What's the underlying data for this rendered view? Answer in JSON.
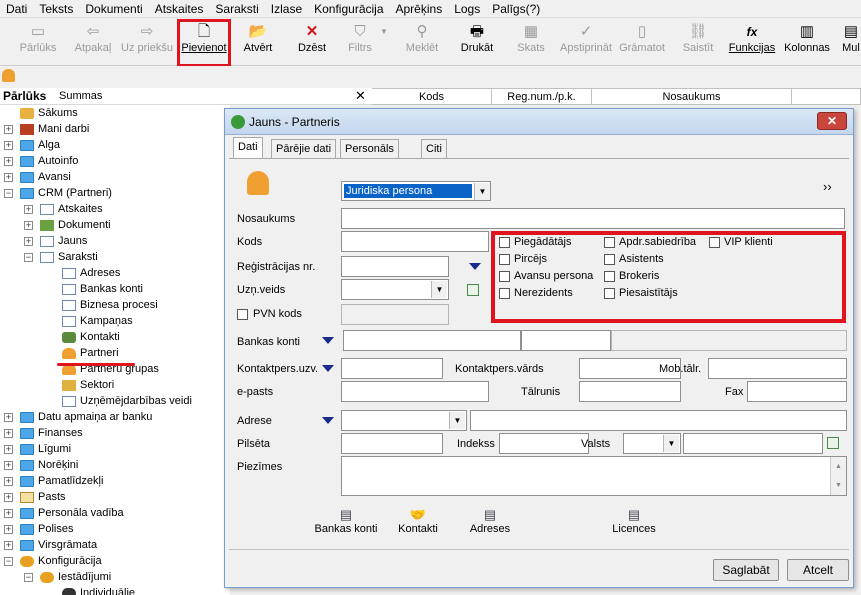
{
  "menubar": [
    "Dati",
    "Teksts",
    "Dokumenti",
    "Atskaites",
    "Saraksti",
    "Izlase",
    "Konfigurācija",
    "Aprēķins",
    "Logs",
    "Palīgs(?)"
  ],
  "toolbar": {
    "parluks": "Pārlūks",
    "atpakal": "Atpakaļ",
    "uzpriekšu": "Uz priekšu",
    "pievienot": "Pievienot",
    "atvert": "Atvērt",
    "dzest": "Dzēst",
    "filtrs": "Filtrs",
    "meklet": "Meklēt",
    "drukat": "Drukāt",
    "skats": "Skats",
    "apstiprinat": "Apstiprināt",
    "gramatot": "Grāmatot",
    "saistit": "Saistīt",
    "funkcijas": "Funkcijas",
    "kolonnas": "Kolonnas",
    "mul": "Mul"
  },
  "tree_header": {
    "title": "Pārlūks",
    "summas": "Summas",
    "close": "✕"
  },
  "grid_header": {
    "kods": "Kods",
    "regnum": "Reg.num./p.k.",
    "nosaukums": "Nosaukums"
  },
  "tree": {
    "sakums": "Sākums",
    "mani_darbi": "Mani darbi",
    "alga": "Alga",
    "autoinfo": "Autoinfo",
    "avansi": "Avansi",
    "crm": "CRM (Partneri)",
    "atskaites": "Atskaites",
    "dokumenti": "Dokumenti",
    "jauns": "Jauns",
    "saraksti": "Saraksti",
    "adreses": "Adreses",
    "bankas_konti": "Bankas konti",
    "biznesa_procesi": "Biznesa procesi",
    "kampanas": "Kampaņas",
    "kontakti": "Kontakti",
    "partneri": "Partneri",
    "partneru_grupas": "Partneru grupas",
    "sektori": "Sektori",
    "uznemdarbibas_veidi": "Uzņēmējdarbības veidi",
    "datu_apmaina": "Datu apmaiņa ar banku",
    "finanses": "Finanses",
    "ligumi": "Līgumi",
    "norekini": "Norēķini",
    "pamatlidzekli": "Pamatlīdzekļi",
    "pasts": "Pasts",
    "personala_vadiba": "Personāla vadība",
    "polises": "Polises",
    "virsgramata": "Virsgrāmata",
    "konfiguracija": "Konfigurācija",
    "iestadijumi": "Iestādījumi",
    "individualie": "Individuālie"
  },
  "dialog": {
    "title": "Jauns - Partneris",
    "close": "✕",
    "tabs": {
      "dati": "Dati",
      "parejie": "Pārējie dati",
      "personals": "Personāls",
      "citi": "Citi"
    },
    "type_value": "Juridiska persona",
    "more": "››",
    "labels": {
      "nosaukums": "Nosaukums",
      "kods": "Kods",
      "reg": "Reģistrācijas nr.",
      "uzn": "Uzņ.veids",
      "pvn": "PVN kods",
      "bankas": "Bankas konti",
      "kontuzv": "Kontaktpers.uzv.",
      "kontvards": "Kontaktpers.vārds",
      "mob": "Mob.tālr.",
      "epasts": "e-pasts",
      "talrunis": "Tālrunis",
      "fax": "Fax",
      "adrese": "Adrese",
      "pilseta": "Pilsēta",
      "indekss": "Indekss",
      "valsts": "Valsts",
      "piezimes": "Piezīmes"
    },
    "checks": {
      "piegadatajs": "Piegādātājs",
      "pircejs": "Pircējs",
      "avansu": "Avansu persona",
      "nerezidents": "Nerezidents",
      "apdr": "Apdr.sabiedrība",
      "asistents": "Asistents",
      "brokeris": "Brokeris",
      "piesaistitajs": "Piesaistītājs",
      "vip": "VIP klienti"
    },
    "bottom": {
      "bankas": "Bankas konti",
      "kontakti": "Kontakti",
      "adreses": "Adreses",
      "licences": "Licences"
    },
    "buttons": {
      "saglabat": "Saglabāt",
      "atcelt": "Atcelt"
    }
  }
}
